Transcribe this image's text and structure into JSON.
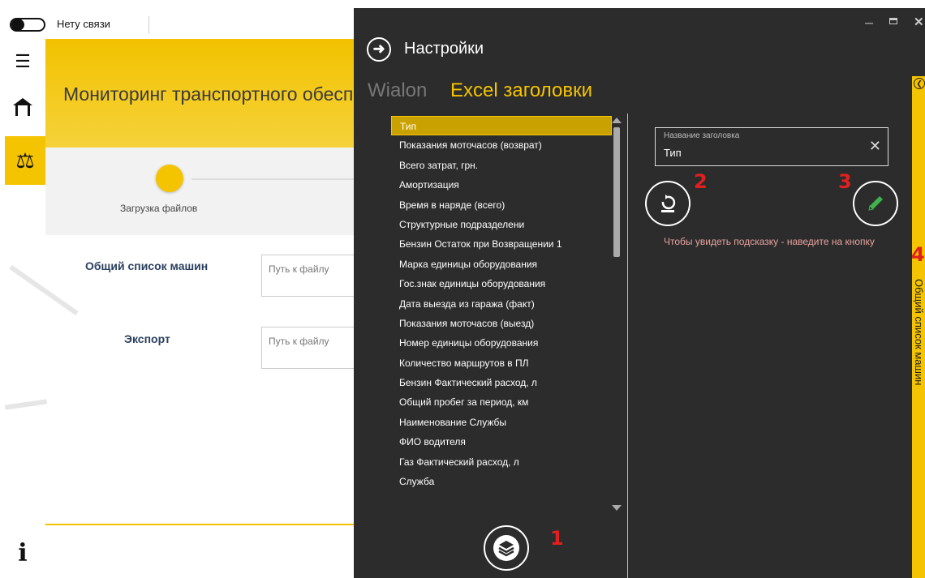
{
  "topbar": {
    "connection_status": "Нету связи"
  },
  "banner": {
    "title": "Мониторинг транспортного обесп"
  },
  "stepper": {
    "step1_label": "Загрузка файлов"
  },
  "form": {
    "row1_label": "Общий список машин",
    "row1_placeholder": "Путь к файлу",
    "row2_label": "Экспорт",
    "row2_placeholder": "Путь к файлу"
  },
  "settings": {
    "title": "Настройки",
    "tabs": [
      "Wialon",
      "Excel заголовки"
    ],
    "active_tab": "Excel заголовки",
    "header_list": [
      "Тип",
      "Показания моточасов (возврат)",
      "Всего затрат, грн.",
      "Амортизация",
      "Время в наряде (всего)",
      "Структурные подразделени",
      "Бензин Остаток при Возвращении 1",
      "Марка единицы оборудования",
      "Гос.знак единицы оборудования",
      "Дата выезда из гаража (факт)",
      "Показания моточасов (выезд)",
      "Номер единицы оборудования",
      "Количество маршрутов в ПЛ",
      "Бензин Фактический расход, л",
      "Общий пробег за период, км",
      "Наименование Службы",
      "ФИО водителя",
      "Газ Фактический расход, л",
      "Служба"
    ],
    "selected_index": 0,
    "header_field": {
      "label": "Название заголовка",
      "value": "Тип"
    },
    "hint": "Чтобы увидеть подсказку - наведите на кнопку",
    "side_panel_label": "Общий список машин",
    "callouts": [
      "1",
      "2",
      "3",
      "4"
    ]
  },
  "colors": {
    "accent": "#f5c400",
    "dark_bg": "#2c2c2c",
    "callout": "#e02020",
    "hint": "#e8a39f"
  },
  "icons": [
    "menu-icon",
    "home-icon",
    "scales-icon",
    "info-icon",
    "back-arrow-icon",
    "layers-icon",
    "restore-icon",
    "pencil-icon",
    "close-icon",
    "collapse-icon"
  ]
}
